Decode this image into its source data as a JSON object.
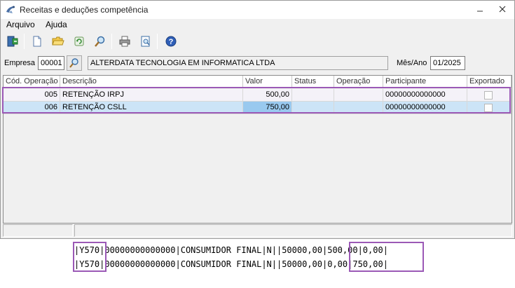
{
  "window": {
    "title": "Receitas e deduções competência"
  },
  "menu": [
    {
      "label": "Arquivo"
    },
    {
      "label": "Ajuda"
    }
  ],
  "toolbar": {
    "icons": [
      "exit-icon",
      "new-document-icon",
      "open-folder-icon",
      "refresh-icon",
      "search-icon",
      "print-icon",
      "preview-icon",
      "help-icon"
    ]
  },
  "form": {
    "empresa_label": "Empresa",
    "empresa_code": "00001",
    "empresa_name": "ALTERDATA TECNOLOGIA EM INFORMATICA LTDA",
    "mesano_label": "Mês/Ano",
    "mesano_value": "01/2025"
  },
  "grid": {
    "columns": [
      "Cód. Operação",
      "Descrição",
      "Valor",
      "Status",
      "Operação",
      "Participante",
      "Exportado"
    ],
    "rows": [
      {
        "codigo": "005",
        "descricao": "RETENÇÃO IRPJ",
        "valor": "500,00",
        "status": "",
        "operacao": "",
        "participante": "00000000000000",
        "exportado": false
      },
      {
        "codigo": "006",
        "descricao": "RETENÇÃO CSLL",
        "valor": "750,00",
        "status": "",
        "operacao": "",
        "participante": "00000000000000",
        "exportado": false
      }
    ],
    "selected_row": 1
  },
  "code_lines": [
    {
      "prefix": "|Y570",
      "middle": "|00000000000000|CONSUMIDOR FINAL|N||50000,00|",
      "suffix": "500,00|0,00|"
    },
    {
      "prefix": "|Y570",
      "middle": "|00000000000000|CONSUMIDOR FINAL|N||50000,00|",
      "suffix": "0,00|750,00|"
    }
  ],
  "colors": {
    "highlight": "#9b59b6",
    "selection": "#cce4f7"
  }
}
